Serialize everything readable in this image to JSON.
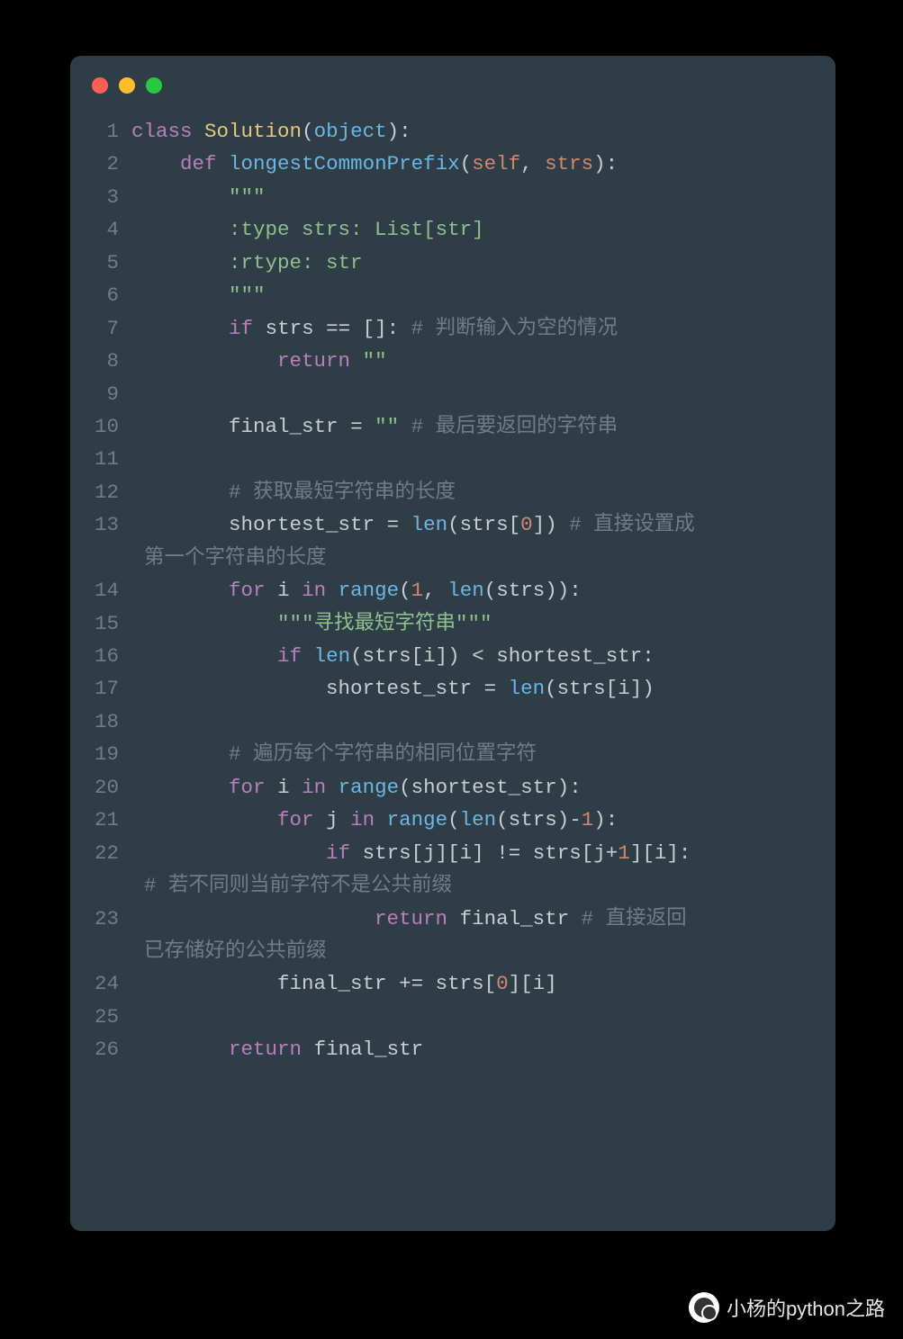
{
  "watermark": {
    "text": "小杨的python之路"
  },
  "code": {
    "language": "python",
    "lines": [
      {
        "n": 1,
        "tokens": [
          [
            "kw",
            "class"
          ],
          [
            "sp",
            " "
          ],
          [
            "cls",
            "Solution"
          ],
          [
            "punc",
            "("
          ],
          [
            "obj",
            "object"
          ],
          [
            "punc",
            ")"
          ],
          [
            "punc",
            ":"
          ]
        ]
      },
      {
        "n": 2,
        "tokens": [
          [
            "sp",
            "    "
          ],
          [
            "kw",
            "def"
          ],
          [
            "sp",
            " "
          ],
          [
            "fn",
            "longestCommonPrefix"
          ],
          [
            "punc",
            "("
          ],
          [
            "self",
            "self"
          ],
          [
            "punc",
            ", "
          ],
          [
            "param",
            "strs"
          ],
          [
            "punc",
            ")"
          ],
          [
            "punc",
            ":"
          ]
        ]
      },
      {
        "n": 3,
        "tokens": [
          [
            "sp",
            "        "
          ],
          [
            "str",
            "\"\"\""
          ]
        ]
      },
      {
        "n": 4,
        "tokens": [
          [
            "sp",
            "        "
          ],
          [
            "str",
            ":type strs: List[str]"
          ]
        ]
      },
      {
        "n": 5,
        "tokens": [
          [
            "sp",
            "        "
          ],
          [
            "str",
            ":rtype: str"
          ]
        ]
      },
      {
        "n": 6,
        "tokens": [
          [
            "sp",
            "        "
          ],
          [
            "str",
            "\"\"\""
          ]
        ]
      },
      {
        "n": 7,
        "tokens": [
          [
            "sp",
            "        "
          ],
          [
            "kw",
            "if"
          ],
          [
            "sp",
            " "
          ],
          [
            "ident",
            "strs"
          ],
          [
            "sp",
            " "
          ],
          [
            "op",
            "=="
          ],
          [
            "sp",
            " "
          ],
          [
            "punc",
            "[]"
          ],
          [
            "punc",
            ":"
          ],
          [
            "sp",
            " "
          ],
          [
            "cmt",
            "# 判断输入为空的情况"
          ]
        ]
      },
      {
        "n": 8,
        "tokens": [
          [
            "sp",
            "            "
          ],
          [
            "kw",
            "return"
          ],
          [
            "sp",
            " "
          ],
          [
            "str",
            "\"\""
          ]
        ]
      },
      {
        "n": 9,
        "tokens": []
      },
      {
        "n": 10,
        "tokens": [
          [
            "sp",
            "        "
          ],
          [
            "ident",
            "final_str"
          ],
          [
            "sp",
            " "
          ],
          [
            "op",
            "="
          ],
          [
            "sp",
            " "
          ],
          [
            "str",
            "\"\""
          ],
          [
            "sp",
            " "
          ],
          [
            "cmt",
            "# 最后要返回的字符串"
          ]
        ]
      },
      {
        "n": 11,
        "tokens": []
      },
      {
        "n": 12,
        "tokens": [
          [
            "sp",
            "        "
          ],
          [
            "cmt",
            "# 获取最短字符串的长度"
          ]
        ]
      },
      {
        "n": 13,
        "tokens": [
          [
            "sp",
            "        "
          ],
          [
            "ident",
            "shortest_str"
          ],
          [
            "sp",
            " "
          ],
          [
            "op",
            "="
          ],
          [
            "sp",
            " "
          ],
          [
            "builtin",
            "len"
          ],
          [
            "punc",
            "("
          ],
          [
            "ident",
            "strs"
          ],
          [
            "punc",
            "["
          ],
          [
            "num",
            "0"
          ],
          [
            "punc",
            "]"
          ],
          [
            "punc",
            ")"
          ],
          [
            "sp",
            " "
          ],
          [
            "cmt",
            "# 直接设置成"
          ]
        ],
        "wrap": [
          [
            "cmt",
            "第一个字符串的长度"
          ]
        ]
      },
      {
        "n": 14,
        "tokens": [
          [
            "sp",
            "        "
          ],
          [
            "kw",
            "for"
          ],
          [
            "sp",
            " "
          ],
          [
            "ident",
            "i"
          ],
          [
            "sp",
            " "
          ],
          [
            "kw",
            "in"
          ],
          [
            "sp",
            " "
          ],
          [
            "builtin",
            "range"
          ],
          [
            "punc",
            "("
          ],
          [
            "num",
            "1"
          ],
          [
            "punc",
            ", "
          ],
          [
            "builtin",
            "len"
          ],
          [
            "punc",
            "("
          ],
          [
            "ident",
            "strs"
          ],
          [
            "punc",
            ")"
          ],
          [
            "punc",
            ")"
          ],
          [
            "punc",
            ":"
          ]
        ]
      },
      {
        "n": 15,
        "tokens": [
          [
            "sp",
            "            "
          ],
          [
            "str",
            "\"\"\"寻找最短字符串\"\"\""
          ]
        ]
      },
      {
        "n": 16,
        "tokens": [
          [
            "sp",
            "            "
          ],
          [
            "kw",
            "if"
          ],
          [
            "sp",
            " "
          ],
          [
            "builtin",
            "len"
          ],
          [
            "punc",
            "("
          ],
          [
            "ident",
            "strs"
          ],
          [
            "punc",
            "["
          ],
          [
            "ident",
            "i"
          ],
          [
            "punc",
            "]"
          ],
          [
            "punc",
            ")"
          ],
          [
            "sp",
            " "
          ],
          [
            "op",
            "<"
          ],
          [
            "sp",
            " "
          ],
          [
            "ident",
            "shortest_str"
          ],
          [
            "punc",
            ":"
          ]
        ]
      },
      {
        "n": 17,
        "tokens": [
          [
            "sp",
            "                "
          ],
          [
            "ident",
            "shortest_str"
          ],
          [
            "sp",
            " "
          ],
          [
            "op",
            "="
          ],
          [
            "sp",
            " "
          ],
          [
            "builtin",
            "len"
          ],
          [
            "punc",
            "("
          ],
          [
            "ident",
            "strs"
          ],
          [
            "punc",
            "["
          ],
          [
            "ident",
            "i"
          ],
          [
            "punc",
            "]"
          ],
          [
            "punc",
            ")"
          ]
        ]
      },
      {
        "n": 18,
        "tokens": []
      },
      {
        "n": 19,
        "tokens": [
          [
            "sp",
            "        "
          ],
          [
            "cmt",
            "# 遍历每个字符串的相同位置字符"
          ]
        ]
      },
      {
        "n": 20,
        "tokens": [
          [
            "sp",
            "        "
          ],
          [
            "kw",
            "for"
          ],
          [
            "sp",
            " "
          ],
          [
            "ident",
            "i"
          ],
          [
            "sp",
            " "
          ],
          [
            "kw",
            "in"
          ],
          [
            "sp",
            " "
          ],
          [
            "builtin",
            "range"
          ],
          [
            "punc",
            "("
          ],
          [
            "ident",
            "shortest_str"
          ],
          [
            "punc",
            ")"
          ],
          [
            "punc",
            ":"
          ]
        ]
      },
      {
        "n": 21,
        "tokens": [
          [
            "sp",
            "            "
          ],
          [
            "kw",
            "for"
          ],
          [
            "sp",
            " "
          ],
          [
            "ident",
            "j"
          ],
          [
            "sp",
            " "
          ],
          [
            "kw",
            "in"
          ],
          [
            "sp",
            " "
          ],
          [
            "builtin",
            "range"
          ],
          [
            "punc",
            "("
          ],
          [
            "builtin",
            "len"
          ],
          [
            "punc",
            "("
          ],
          [
            "ident",
            "strs"
          ],
          [
            "punc",
            ")"
          ],
          [
            "op",
            "-"
          ],
          [
            "num",
            "1"
          ],
          [
            "punc",
            ")"
          ],
          [
            "punc",
            ":"
          ]
        ]
      },
      {
        "n": 22,
        "tokens": [
          [
            "sp",
            "                "
          ],
          [
            "kw",
            "if"
          ],
          [
            "sp",
            " "
          ],
          [
            "ident",
            "strs"
          ],
          [
            "punc",
            "["
          ],
          [
            "ident",
            "j"
          ],
          [
            "punc",
            "]"
          ],
          [
            "punc",
            "["
          ],
          [
            "ident",
            "i"
          ],
          [
            "punc",
            "]"
          ],
          [
            "sp",
            " "
          ],
          [
            "op",
            "!="
          ],
          [
            "sp",
            " "
          ],
          [
            "ident",
            "strs"
          ],
          [
            "punc",
            "["
          ],
          [
            "ident",
            "j"
          ],
          [
            "op",
            "+"
          ],
          [
            "num",
            "1"
          ],
          [
            "punc",
            "]"
          ],
          [
            "punc",
            "["
          ],
          [
            "ident",
            "i"
          ],
          [
            "punc",
            "]"
          ],
          [
            "punc",
            ":"
          ]
        ],
        "wrap": [
          [
            "cmt",
            "# 若不同则当前字符不是公共前缀"
          ]
        ]
      },
      {
        "n": 23,
        "tokens": [
          [
            "sp",
            "                    "
          ],
          [
            "kw",
            "return"
          ],
          [
            "sp",
            " "
          ],
          [
            "ident",
            "final_str"
          ],
          [
            "sp",
            " "
          ],
          [
            "cmt",
            "# 直接返回"
          ]
        ],
        "wrap": [
          [
            "cmt",
            "已存储好的公共前缀"
          ]
        ]
      },
      {
        "n": 24,
        "tokens": [
          [
            "sp",
            "            "
          ],
          [
            "ident",
            "final_str"
          ],
          [
            "sp",
            " "
          ],
          [
            "op",
            "+="
          ],
          [
            "sp",
            " "
          ],
          [
            "ident",
            "strs"
          ],
          [
            "punc",
            "["
          ],
          [
            "num",
            "0"
          ],
          [
            "punc",
            "]"
          ],
          [
            "punc",
            "["
          ],
          [
            "ident",
            "i"
          ],
          [
            "punc",
            "]"
          ]
        ]
      },
      {
        "n": 25,
        "tokens": []
      },
      {
        "n": 26,
        "tokens": [
          [
            "sp",
            "        "
          ],
          [
            "kw",
            "return"
          ],
          [
            "sp",
            " "
          ],
          [
            "ident",
            "final_str"
          ]
        ]
      }
    ]
  }
}
